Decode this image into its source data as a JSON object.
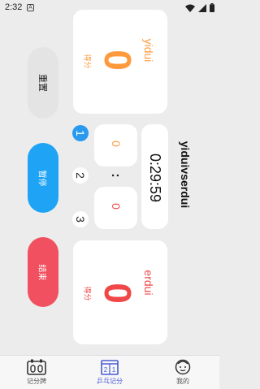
{
  "status": {
    "time": "2:32",
    "notif": "A"
  },
  "team1": {
    "name": "yidui",
    "score": "0",
    "score_label": "得分"
  },
  "team2": {
    "name": "erdui",
    "score": "0",
    "score_label": "得分"
  },
  "match_title": "yiduivserdui",
  "timer": "0:29:59",
  "games": {
    "team1": "0",
    "team2": "0",
    "separator": ":"
  },
  "game_numbers": [
    "1",
    "2",
    "3"
  ],
  "buttons": {
    "reset": "重置",
    "pause": "暂停",
    "end": "结束"
  },
  "tabs": [
    {
      "label": "记分牌",
      "icon": "scoreboard-icon"
    },
    {
      "label": "乒乓记分",
      "icon": "table-tennis-scores-icon"
    },
    {
      "label": "我的",
      "icon": "profile-icon"
    }
  ],
  "colors": {
    "team1": "#ff9a3c",
    "team2": "#f04848",
    "pause": "#1ea3f5",
    "end": "#f05060",
    "active_tab": "#4a5bd4"
  }
}
